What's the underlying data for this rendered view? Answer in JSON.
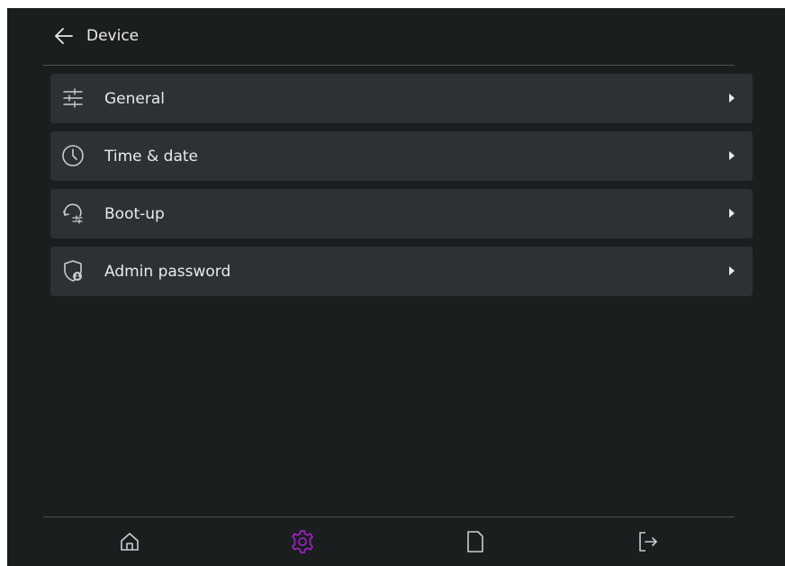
{
  "header": {
    "title": "Device",
    "back_icon": "arrow-left-icon"
  },
  "menu": {
    "items": [
      {
        "label": "General",
        "icon": "sliders-icon"
      },
      {
        "label": "Time & date",
        "icon": "clock-icon"
      },
      {
        "label": "Boot-up",
        "icon": "boot-up-icon"
      },
      {
        "label": "Admin password",
        "icon": "shield-lock-icon"
      }
    ]
  },
  "bottom_nav": {
    "items": [
      {
        "icon": "home-icon",
        "active": false
      },
      {
        "icon": "gear-icon",
        "active": true
      },
      {
        "icon": "document-icon",
        "active": false
      },
      {
        "icon": "logout-icon",
        "active": false
      }
    ]
  },
  "colors": {
    "background": "#1b1e1f",
    "card": "#2c3134",
    "text": "#e8eaeb",
    "icon": "#c9cdd0",
    "active_accent": "#a020c8",
    "divider": "#4a4f52"
  }
}
